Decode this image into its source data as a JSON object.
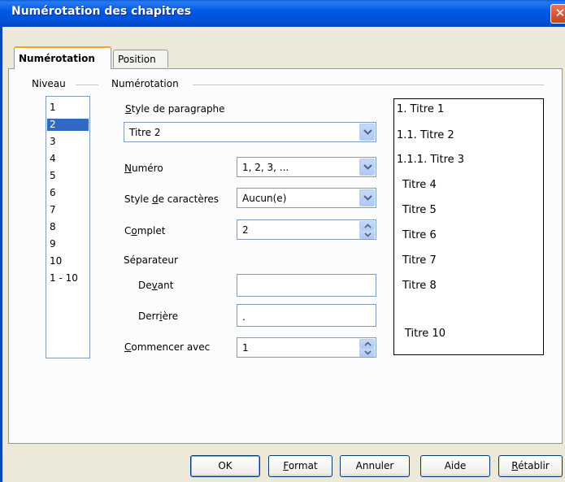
{
  "window": {
    "title": "Numérotation des chapitres",
    "close_glyph": "✕"
  },
  "tabs": [
    {
      "label": "Numérotation",
      "active": true
    },
    {
      "label": "Position",
      "active": false
    }
  ],
  "level": {
    "group_label": "Niveau",
    "items": [
      "1",
      "2",
      "3",
      "4",
      "5",
      "6",
      "7",
      "8",
      "9",
      "10",
      "1 - 10"
    ],
    "selected": "2"
  },
  "numbering": {
    "group_label": "Numérotation",
    "paragraph_style_label_u": "S",
    "paragraph_style_label_rest": "tyle de paragraphe",
    "paragraph_style_value": "Titre 2",
    "number_label_u": "N",
    "number_label_rest": "uméro",
    "number_value": "1, 2, 3, ...",
    "char_style_label_pre": "Style ",
    "char_style_label_u": "d",
    "char_style_label_rest": "e caractères",
    "char_style_value": "Aucun(e)",
    "complete_label_pre": "C",
    "complete_label_u": "o",
    "complete_label_rest": "mplet",
    "complete_value": "2",
    "separator_label": "Séparateur",
    "before_label_pre": "De",
    "before_label_u": "v",
    "before_label_rest": "ant",
    "before_value": "",
    "after_label_pre": "Derr",
    "after_label_u": "i",
    "after_label_rest": "ère",
    "after_value": ".",
    "start_label_u": "C",
    "start_label_rest": "ommencer avec",
    "start_value": "1"
  },
  "preview": {
    "lines": [
      "1. Titre 1",
      "1.1. Titre 2",
      "1.1.1. Titre 3",
      "Titre 4",
      "Titre 5",
      "Titre 6",
      "Titre 7",
      "Titre 8",
      "Titre 10"
    ]
  },
  "buttons": {
    "ok": "OK",
    "format_u": "F",
    "format_rest": "ormat",
    "cancel": "Annuler",
    "help": "Aide",
    "reset_u": "R",
    "reset_rest": "établir"
  }
}
